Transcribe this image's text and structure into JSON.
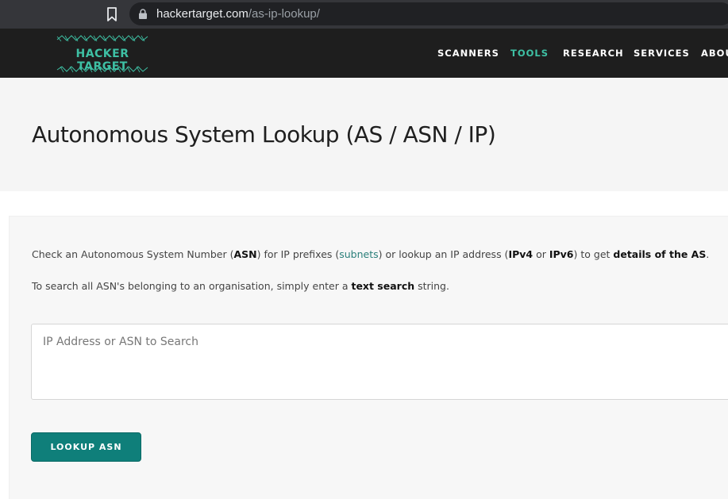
{
  "browser": {
    "url_domain": "hackertarget.com",
    "url_path": "/as-ip-lookup/",
    "bookmark_icon": "bookmark-icon",
    "lock_icon": "lock-icon"
  },
  "header": {
    "logo_text": "HACKER TARGET",
    "nav": [
      {
        "label": "SCANNERS",
        "active": false
      },
      {
        "label": "TOOLS",
        "active": true
      },
      {
        "label": "RESEARCH",
        "active": false
      },
      {
        "label": "SERVICES",
        "active": false
      },
      {
        "label": "ABOUT",
        "active": false
      }
    ],
    "accent_color": "#3ec0a4"
  },
  "hero": {
    "title": "Autonomous System Lookup (AS / ASN / IP)"
  },
  "content": {
    "line1": {
      "t1": "Check an Autonomous System Number (",
      "b1": "ASN",
      "t2": ") for IP prefixes (",
      "link": "subnets",
      "t3": ") or lookup an IP address (",
      "b2": "IPv4",
      "t4": " or ",
      "b3": "IPv6",
      "t5": ") to get ",
      "b4": "details of the AS",
      "t6": "."
    },
    "line2": {
      "t1": "To search all ASN's belonging to an organisation, simply enter a ",
      "b1": "text search",
      "t2": " string."
    },
    "search_placeholder": "IP Address or ASN to Search",
    "search_value": "",
    "button_label": "LOOKUP ASN",
    "button_color": "#0f7f7a"
  }
}
